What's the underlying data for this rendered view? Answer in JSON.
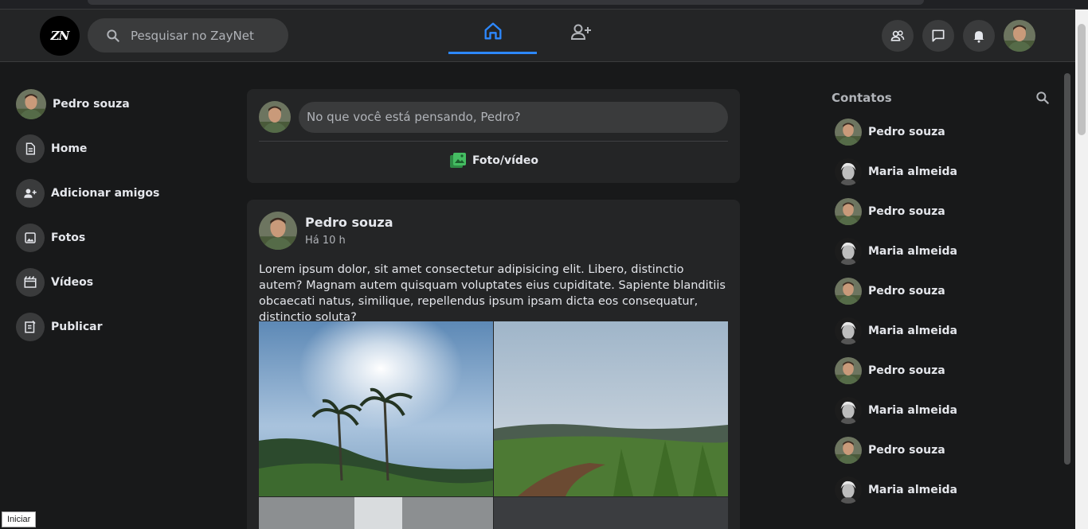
{
  "app": {
    "logo_text": "ZN"
  },
  "header": {
    "search_placeholder": "Pesquisar no ZayNet",
    "nav": [
      {
        "name": "home",
        "active": true
      },
      {
        "name": "add-friends",
        "active": false
      }
    ]
  },
  "sidebar": {
    "profile_name": "Pedro souza",
    "items": [
      {
        "label": "Home",
        "icon": "document-icon"
      },
      {
        "label": "Adicionar amigos",
        "icon": "person-add-icon"
      },
      {
        "label": "Fotos",
        "icon": "image-icon"
      },
      {
        "label": "Vídeos",
        "icon": "video-icon"
      },
      {
        "label": "Publicar",
        "icon": "publish-icon"
      }
    ]
  },
  "composer": {
    "placeholder": "No que você está pensando, Pedro?",
    "photo_label": "Foto/vídeo"
  },
  "post": {
    "author": "Pedro souza",
    "time": "Há 10 h",
    "text": "Lorem ipsum dolor, sit amet consectetur adipisicing elit. Libero, distinctio autem? Magnam autem quisquam voluptates eius cupiditate. Sapiente blanditiis obcaecati natus, similique, repellendus ipsum ipsam dicta eos consequatur, distinctio soluta?"
  },
  "contacts": {
    "title": "Contatos",
    "list": [
      {
        "name": "Pedro souza"
      },
      {
        "name": "Maria almeida"
      },
      {
        "name": "Pedro souza"
      },
      {
        "name": "Maria almeida"
      },
      {
        "name": "Pedro souza"
      },
      {
        "name": "Maria almeida"
      },
      {
        "name": "Pedro souza"
      },
      {
        "name": "Maria almeida"
      },
      {
        "name": "Pedro souza"
      },
      {
        "name": "Maria almeida"
      }
    ]
  },
  "status_tip": "Iniciar",
  "colors": {
    "accent": "#2d88ff",
    "background": "#18191a",
    "surface": "#242526",
    "photo_icon": "#45bd62"
  }
}
